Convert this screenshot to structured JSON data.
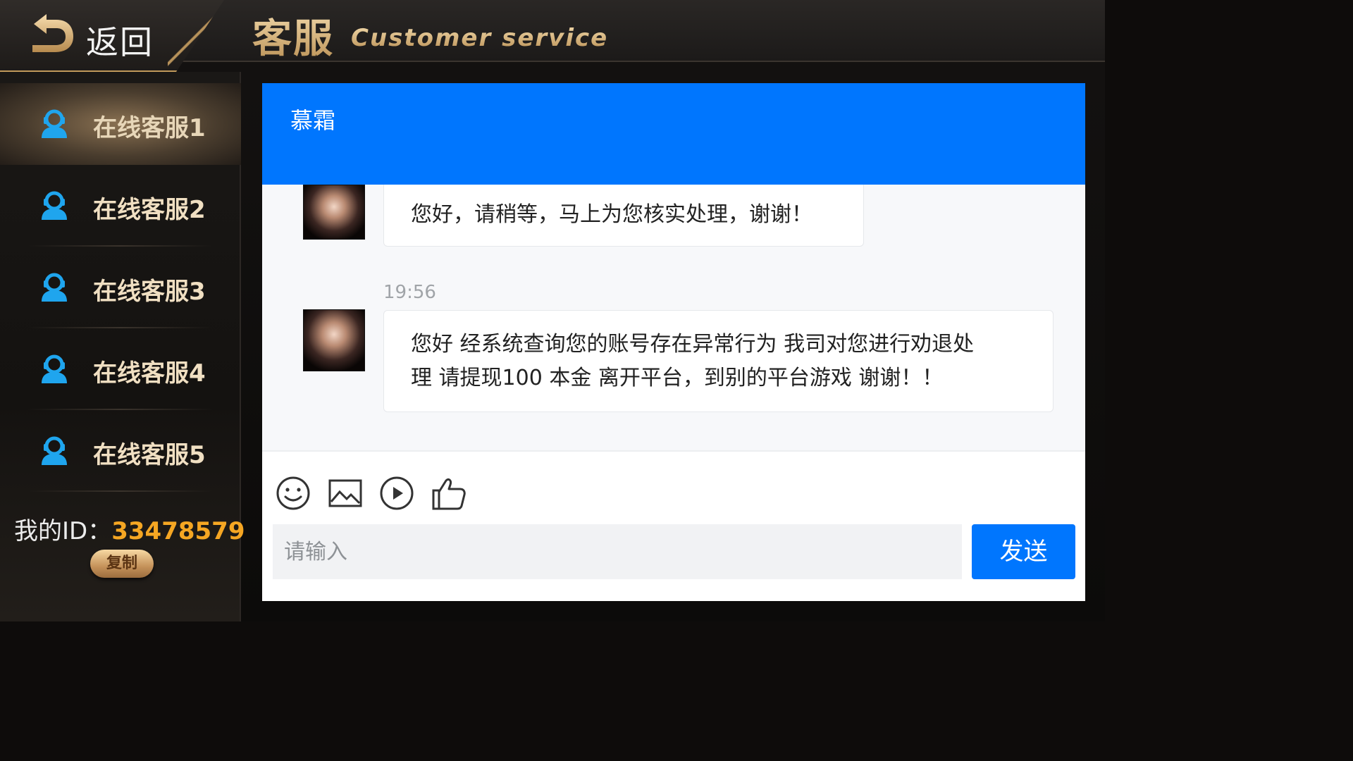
{
  "header": {
    "back_label": "返回",
    "title_cn": "客服",
    "title_en": "Customer service"
  },
  "sidebar": {
    "items": [
      {
        "label": "在线客服1",
        "active": true
      },
      {
        "label": "在线客服2",
        "active": false
      },
      {
        "label": "在线客服3",
        "active": false
      },
      {
        "label": "在线客服4",
        "active": false
      },
      {
        "label": "在线客服5",
        "active": false
      }
    ],
    "id_label": "我的ID：",
    "id_value": "33478579",
    "copy_label": "复制"
  },
  "chat": {
    "agent_name": "慕霜",
    "messages": [
      {
        "text": "您好，请稍等，马上为您核实处理，谢谢！"
      },
      {
        "timestamp": "19:56",
        "line1": "您好 经系统查询您的账号存在异常行为 我司对您进行劝退处",
        "line2": "理 请提现100 本金 离开平台，到别的平台游戏 谢谢！！"
      }
    ],
    "tools": [
      "smiley-icon",
      "image-icon",
      "video-play-icon",
      "thumbs-up-icon"
    ],
    "input_placeholder": "请输入",
    "send_label": "发送"
  },
  "colors": {
    "accent_blue": "#0076fe",
    "gold": "#d9b37a",
    "id_orange": "#f5a623"
  }
}
